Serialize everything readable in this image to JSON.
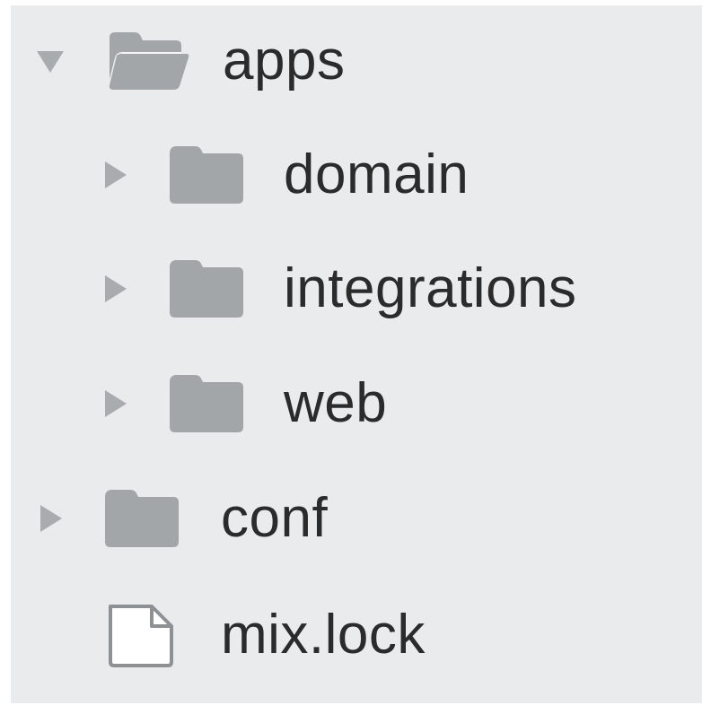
{
  "tree": {
    "items": [
      {
        "label": "apps",
        "type": "folder",
        "state": "expanded",
        "depth": 0,
        "icon": "folder-open-icon"
      },
      {
        "label": "domain",
        "type": "folder",
        "state": "collapsed",
        "depth": 1,
        "icon": "folder-icon"
      },
      {
        "label": "integrations",
        "type": "folder",
        "state": "collapsed",
        "depth": 1,
        "icon": "folder-icon"
      },
      {
        "label": "web",
        "type": "folder",
        "state": "collapsed",
        "depth": 1,
        "icon": "folder-icon"
      },
      {
        "label": "conf",
        "type": "folder",
        "state": "collapsed",
        "depth": 0,
        "icon": "folder-icon"
      },
      {
        "label": "mix.lock",
        "type": "file",
        "depth": 0,
        "icon": "file-icon"
      }
    ]
  },
  "colors": {
    "background": "#e9ebed",
    "folder": "#a3a6a9",
    "chevron": "#a9acaf",
    "text": "#2b2b2b",
    "file_stroke": "#8e9194"
  }
}
